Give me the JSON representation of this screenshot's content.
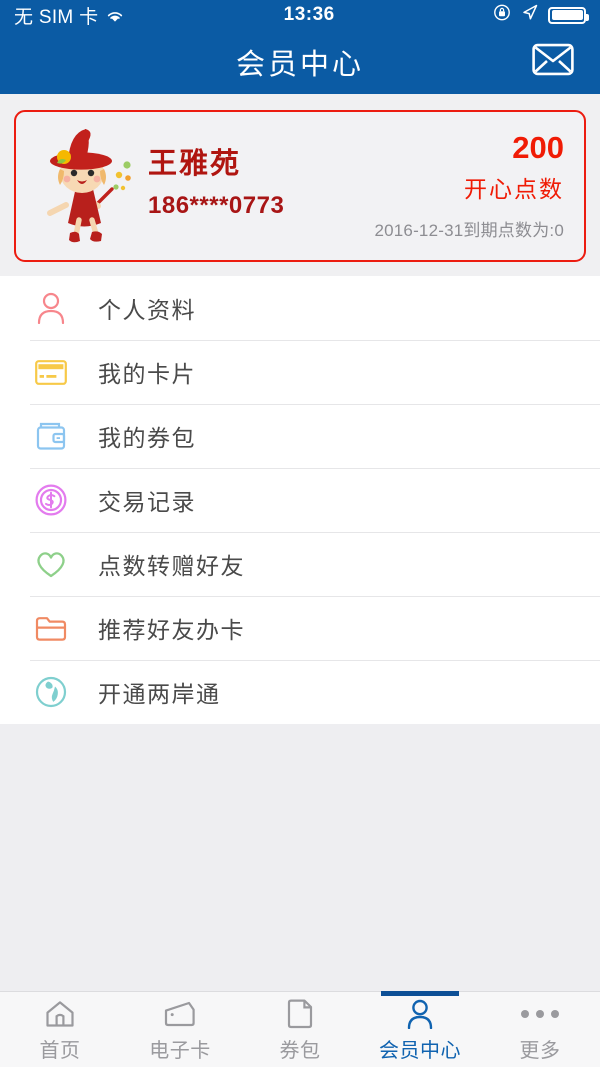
{
  "status_bar": {
    "carrier": "无 SIM 卡",
    "wifi_icon": "wifi-icon",
    "time": "13:36",
    "rotation_lock_icon": "rotation-lock-icon",
    "location_icon": "location-arrow-icon",
    "battery_icon": "battery-full-icon"
  },
  "header": {
    "title": "会员中心",
    "mail_icon": "envelope-icon",
    "background_color": "#0b5ba4"
  },
  "member_card": {
    "avatar_icon": "witch-mascot-avatar",
    "name": "王雅苑",
    "phone": "186****0773",
    "points": "200",
    "points_label": "开心点数",
    "expiry_note": "2016-12-31到期点数为:0",
    "border_color": "#ec1c10",
    "name_color": "#b01510",
    "points_color": "#f01b05"
  },
  "menu": {
    "items": [
      {
        "label": "个人资料",
        "icon": "person-icon",
        "color": "#f7868c"
      },
      {
        "label": "我的卡片",
        "icon": "credit-card-icon",
        "color": "#f7c948"
      },
      {
        "label": "我的券包",
        "icon": "wallet-icon",
        "color": "#8cc5f0"
      },
      {
        "label": "交易记录",
        "icon": "coin-dollar-icon",
        "color": "#e37bee"
      },
      {
        "label": "点数转赠好友",
        "icon": "heart-icon",
        "color": "#8ed08a"
      },
      {
        "label": "推荐好友办卡",
        "icon": "folder-icon",
        "color": "#f08a63"
      },
      {
        "label": "开通两岸通",
        "icon": "globe-icon",
        "color": "#7fcfcf"
      }
    ]
  },
  "tabbar": {
    "active_color": "#1063b0",
    "inactive_color": "#9a9a9e",
    "items": [
      {
        "label": "首页",
        "icon": "home-icon",
        "active": false
      },
      {
        "label": "电子卡",
        "icon": "card-icon",
        "active": false
      },
      {
        "label": "券包",
        "icon": "voucher-icon",
        "active": false
      },
      {
        "label": "会员中心",
        "icon": "person-icon",
        "active": true
      },
      {
        "label": "更多",
        "icon": "more-dots-icon",
        "active": false
      }
    ]
  }
}
